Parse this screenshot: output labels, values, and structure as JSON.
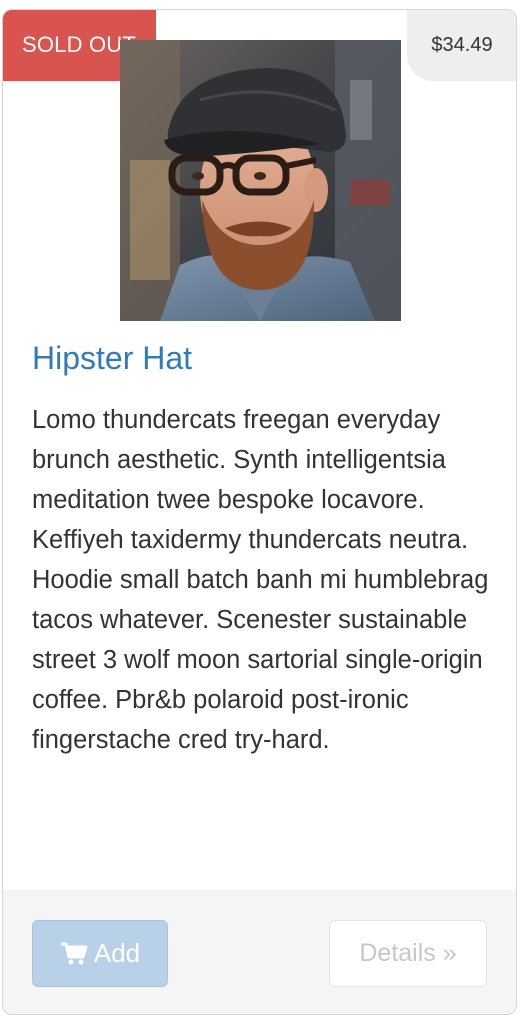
{
  "product": {
    "status_badge": "SOLD OUT",
    "price": "$34.49",
    "name": "Hipster Hat",
    "description": "Lomo thundercats freegan everyday brunch aesthetic. Synth intelligentsia meditation twee bespoke locavore. Keffiyeh taxidermy thundercats neutra. Hoodie small batch banh mi humblebrag tacos whatever. Scenester sustainable street 3 wolf moon sartorial single-origin coffee. Pbr&b polaroid post-ironic fingerstache cred try-hard.",
    "image_alt": "Hipster Hat"
  },
  "actions": {
    "add_label": "Add",
    "add_icon": "shopping-cart-icon",
    "details_label": "Details »",
    "disabled": true
  },
  "colors": {
    "sold_out_badge": "#d9534f",
    "price_badge": "#eeeeee",
    "title_link": "#337ab7",
    "add_button": "#b8d0e8",
    "footer": "#f5f5f5"
  }
}
